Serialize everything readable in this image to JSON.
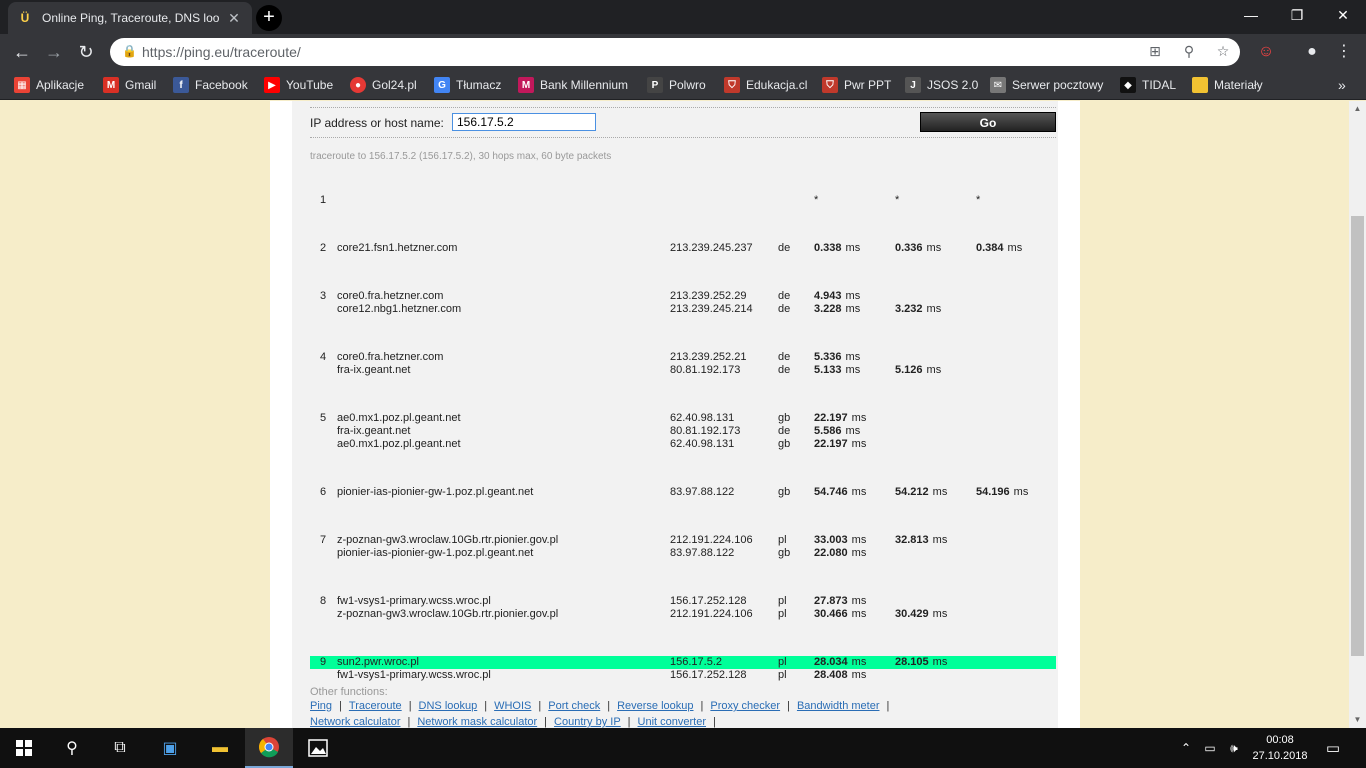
{
  "browser": {
    "tab_title": "Online Ping, Traceroute, DNS loo",
    "url": "https://ping.eu/traceroute/",
    "window_controls": [
      "minimize-icon",
      "restore-icon",
      "close-icon"
    ],
    "bookmarks": [
      {
        "label": "Aplikacje",
        "icon": "apps-grid-icon",
        "color": "#ea4335"
      },
      {
        "label": "Gmail",
        "icon": "gmail-icon",
        "color": "#d93025"
      },
      {
        "label": "Facebook",
        "icon": "facebook-icon",
        "color": "#3b5998"
      },
      {
        "label": "YouTube",
        "icon": "youtube-icon",
        "color": "#ff0000"
      },
      {
        "label": "Gol24.pl",
        "icon": "gol24-icon",
        "color": "#e53935"
      },
      {
        "label": "Tłumacz",
        "icon": "translate-icon",
        "color": "#4285f4"
      },
      {
        "label": "Bank Millennium",
        "icon": "millennium-icon",
        "color": "#c2185b"
      },
      {
        "label": "Polwro",
        "icon": "polwro-icon",
        "color": "#444444"
      },
      {
        "label": "Edukacja.cl",
        "icon": "edukacja-icon",
        "color": "#c0392b"
      },
      {
        "label": "Pwr PPT",
        "icon": "pwr-icon",
        "color": "#c0392b"
      },
      {
        "label": "JSOS 2.0",
        "icon": "jsos-icon",
        "color": "#555555"
      },
      {
        "label": "Serwer pocztowy",
        "icon": "mail-server-icon",
        "color": "#777777"
      },
      {
        "label": "TIDAL",
        "icon": "tidal-icon",
        "color": "#111111"
      },
      {
        "label": "Materiały",
        "icon": "folder-icon",
        "color": "#f1c232"
      }
    ]
  },
  "form": {
    "label": "IP address or host name:",
    "value": "156.17.5.2",
    "go_label": "Go"
  },
  "trace_info": "traceroute to 156.17.5.2 (156.17.5.2), 30 hops max, 60 byte packets",
  "hops": [
    {
      "num": "1",
      "rows": [
        {
          "host": "",
          "ip": "",
          "cc": "",
          "t1": "*",
          "t2": "*",
          "t3": "*"
        }
      ]
    },
    {
      "num": "2",
      "rows": [
        {
          "host": "core21.fsn1.hetzner.com",
          "ip": "213.239.245.237",
          "cc": "de",
          "t1": "0.338",
          "t2": "0.336",
          "t3": "0.384"
        }
      ]
    },
    {
      "num": "3",
      "rows": [
        {
          "host": "core0.fra.hetzner.com",
          "ip": "213.239.252.29",
          "cc": "de",
          "t1": "4.943",
          "t2": "",
          "t3": ""
        },
        {
          "host": "core12.nbg1.hetzner.com",
          "ip": "213.239.245.214",
          "cc": "de",
          "t1": "3.228",
          "t2": "3.232",
          "t3": ""
        }
      ]
    },
    {
      "num": "4",
      "rows": [
        {
          "host": "core0.fra.hetzner.com",
          "ip": "213.239.252.21",
          "cc": "de",
          "t1": "5.336",
          "t2": "",
          "t3": ""
        },
        {
          "host": "fra-ix.geant.net",
          "ip": "80.81.192.173",
          "cc": "de",
          "t1": "5.133",
          "t2": "5.126",
          "t3": ""
        }
      ]
    },
    {
      "num": "5",
      "rows": [
        {
          "host": "ae0.mx1.poz.pl.geant.net",
          "ip": "62.40.98.131",
          "cc": "gb",
          "t1": "22.197",
          "t2": "",
          "t3": ""
        },
        {
          "host": "fra-ix.geant.net",
          "ip": "80.81.192.173",
          "cc": "de",
          "t1": "5.586",
          "t2": "",
          "t3": ""
        },
        {
          "host": "ae0.mx1.poz.pl.geant.net",
          "ip": "62.40.98.131",
          "cc": "gb",
          "t1": "22.197",
          "t2": "",
          "t3": ""
        }
      ]
    },
    {
      "num": "6",
      "rows": [
        {
          "host": "pionier-ias-pionier-gw-1.poz.pl.geant.net",
          "ip": "83.97.88.122",
          "cc": "gb",
          "t1": "54.746",
          "t2": "54.212",
          "t3": "54.196"
        }
      ]
    },
    {
      "num": "7",
      "rows": [
        {
          "host": "z-poznan-gw3.wroclaw.10Gb.rtr.pionier.gov.pl",
          "ip": "212.191.224.106",
          "cc": "pl",
          "t1": "33.003",
          "t2": "32.813",
          "t3": ""
        },
        {
          "host": "pionier-ias-pionier-gw-1.poz.pl.geant.net",
          "ip": "83.97.88.122",
          "cc": "gb",
          "t1": "22.080",
          "t2": "",
          "t3": ""
        }
      ]
    },
    {
      "num": "8",
      "rows": [
        {
          "host": "fw1-vsys1-primary.wcss.wroc.pl",
          "ip": "156.17.252.128",
          "cc": "pl",
          "t1": "27.873",
          "t2": "",
          "t3": ""
        },
        {
          "host": "z-poznan-gw3.wroclaw.10Gb.rtr.pionier.gov.pl",
          "ip": "212.191.224.106",
          "cc": "pl",
          "t1": "30.466",
          "t2": "30.429",
          "t3": ""
        }
      ]
    },
    {
      "num": "9",
      "highlight": true,
      "rows": [
        {
          "host": "sun2.pwr.wroc.pl",
          "ip": "156.17.5.2",
          "cc": "pl",
          "t1": "28.034",
          "t2": "28.105",
          "t3": ""
        },
        {
          "host": "fw1-vsys1-primary.wcss.wroc.pl",
          "ip": "156.17.252.128",
          "cc": "pl",
          "t1": "28.408",
          "t2": "",
          "t3": ""
        }
      ]
    }
  ],
  "ms_unit": "ms",
  "other": {
    "title": "Other functions:",
    "links_row1": [
      "Ping",
      "Traceroute",
      "DNS lookup",
      "WHOIS",
      "Port check",
      "Reverse lookup",
      "Proxy checker",
      "Bandwidth meter"
    ],
    "links_row2": [
      "Network calculator",
      "Network mask calculator",
      "Country by IP",
      "Unit converter"
    ]
  },
  "taskbar": {
    "time": "00:08",
    "date": "27.10.2018",
    "highlight_color": "#00ff99"
  }
}
